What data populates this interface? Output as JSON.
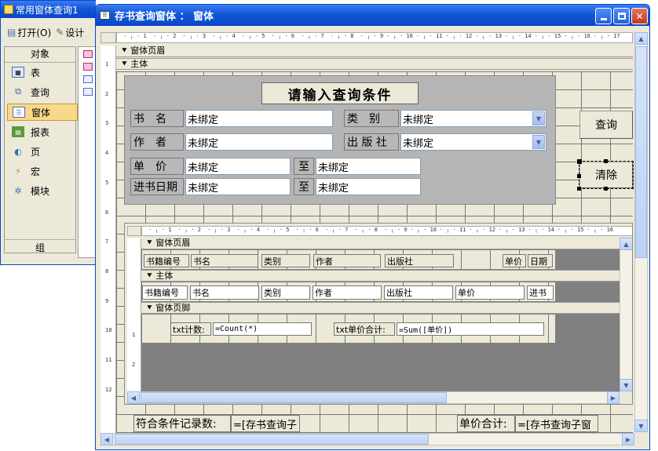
{
  "bg_window": {
    "title": "常用窗体查询1",
    "toolbar": {
      "open_label": "打开(O)",
      "design_label": "设计"
    },
    "objects_header": "对象",
    "groups_label": "组",
    "nav_items": [
      {
        "label": "表",
        "icon": "table-icon"
      },
      {
        "label": "查询",
        "icon": "query-icon"
      },
      {
        "label": "窗体",
        "icon": "form-icon",
        "selected": true
      },
      {
        "label": "报表",
        "icon": "report-icon"
      },
      {
        "label": "页",
        "icon": "page-icon"
      },
      {
        "label": "宏",
        "icon": "macro-icon"
      },
      {
        "label": "模块",
        "icon": "module-icon"
      }
    ]
  },
  "design_window": {
    "title": "存书查询窗体 ： 窗体",
    "ruler_marks": [
      "1",
      "2",
      "3",
      "4",
      "5",
      "6",
      "7",
      "8",
      "9",
      "10",
      "11",
      "12",
      "13",
      "14",
      "15",
      "16",
      "17"
    ],
    "vruler_marks": [
      "1",
      "2",
      "3",
      "4",
      "5",
      "6",
      "7",
      "8",
      "9",
      "10",
      "11",
      "12"
    ],
    "sections": {
      "header": "窗体页眉",
      "detail": "主体"
    },
    "criteria_title": "请输入查询条件",
    "fields": {
      "title_label": "书　名",
      "title_value": "未绑定",
      "category_label": "类　别",
      "category_value": "未绑定",
      "author_label": "作　者",
      "author_value": "未绑定",
      "publisher_label": "出 版 社",
      "publisher_value": "未绑定",
      "price_label": "单　价",
      "price_from": "未绑定",
      "price_to_label": "至",
      "price_to": "未绑定",
      "date_label": "进书日期",
      "date_from": "未绑定",
      "date_to_label": "至",
      "date_to": "未绑定"
    },
    "buttons": {
      "query": "查询",
      "clear": "清除"
    },
    "subform": {
      "ruler_marks": [
        "1",
        "2",
        "3",
        "4",
        "5",
        "6",
        "7",
        "8",
        "9",
        "10",
        "11",
        "12",
        "13",
        "14",
        "15",
        "16"
      ],
      "vruler_marks": [
        "1",
        "2"
      ],
      "header_section": "窗体页眉",
      "detail_section": "主体",
      "footer_section": "窗体页脚",
      "header_labels": [
        "书籍编号",
        "书名",
        "类别",
        "作者",
        "出版社",
        "单价",
        "日期"
      ],
      "detail_fields": [
        "书籍编号",
        "书名",
        "类别",
        "作者",
        "出版社",
        "单价",
        "进书"
      ],
      "footer": {
        "count_label": "txt计数:",
        "count_value": "=Count(*)",
        "sum_label": "txt单价合计:",
        "sum_value": "=Sum([单价])"
      }
    },
    "bottom": {
      "count_label": "符合条件记录数:",
      "count_value": "=[存书查询子",
      "sum_label": "单价合计:",
      "sum_value": "=[存书查询子窗"
    }
  }
}
